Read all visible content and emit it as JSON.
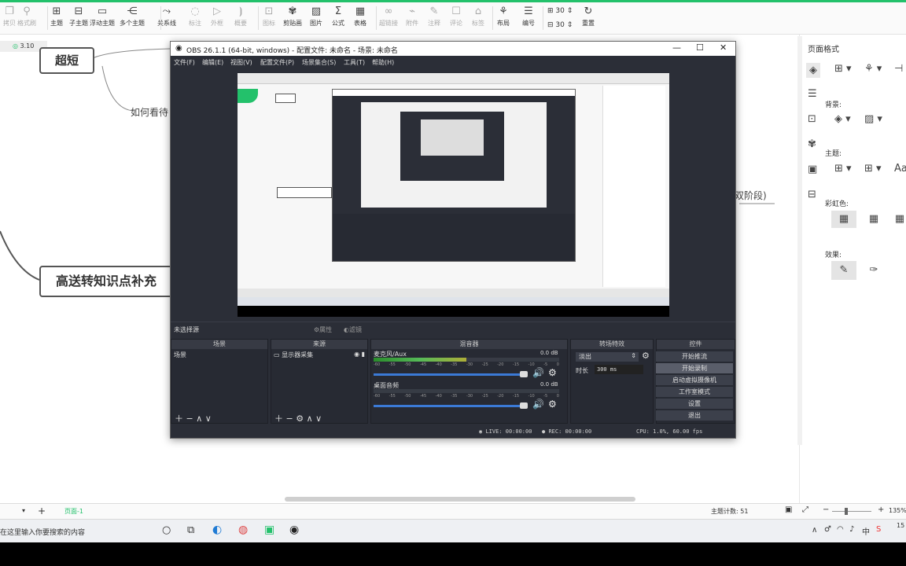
{
  "toolbar": {
    "items": [
      {
        "label": "拷贝",
        "icon": "copy-icon",
        "glyph": "❐",
        "disabled": true
      },
      {
        "label": "格式刷",
        "icon": "format-brush-icon",
        "glyph": "⚲",
        "disabled": true
      },
      {
        "label": "主题",
        "icon": "topic-icon",
        "glyph": "⊞",
        "disabled": false
      },
      {
        "label": "子主题",
        "icon": "subtopic-icon",
        "glyph": "⊟",
        "disabled": false
      },
      {
        "label": "浮动主题",
        "icon": "floating-topic-icon",
        "glyph": "▭",
        "disabled": false
      },
      {
        "label": "多个主题",
        "icon": "multi-topic-icon",
        "glyph": "⋲",
        "disabled": false
      },
      {
        "label": "关系线",
        "icon": "relation-line-icon",
        "glyph": "⤳",
        "disabled": false
      },
      {
        "label": "标注",
        "icon": "callout-icon",
        "glyph": "◌",
        "disabled": true
      },
      {
        "label": "外框",
        "icon": "boundary-icon",
        "glyph": "▷",
        "disabled": true
      },
      {
        "label": "概要",
        "icon": "summary-icon",
        "glyph": "⦘",
        "disabled": true
      },
      {
        "label": "图标",
        "icon": "icon-library-icon",
        "glyph": "⊡",
        "disabled": true
      },
      {
        "label": "剪贴画",
        "icon": "clipart-icon",
        "glyph": "✾",
        "disabled": false
      },
      {
        "label": "图片",
        "icon": "image-icon",
        "glyph": "▨",
        "disabled": false
      },
      {
        "label": "公式",
        "icon": "formula-icon",
        "glyph": "Σ",
        "disabled": false
      },
      {
        "label": "表格",
        "icon": "table-icon",
        "glyph": "▦",
        "disabled": false
      },
      {
        "label": "超链接",
        "icon": "hyperlink-icon",
        "glyph": "∞",
        "disabled": true
      },
      {
        "label": "附件",
        "icon": "attachment-icon",
        "glyph": "⌁",
        "disabled": true
      },
      {
        "label": "注释",
        "icon": "note-icon",
        "glyph": "✎",
        "disabled": true
      },
      {
        "label": "评论",
        "icon": "comment-icon",
        "glyph": "☐",
        "disabled": true
      },
      {
        "label": "标签",
        "icon": "tag-icon",
        "glyph": "⌂",
        "disabled": true
      },
      {
        "label": "布局",
        "icon": "layout-icon",
        "glyph": "⚘",
        "disabled": false
      },
      {
        "label": "编号",
        "icon": "numbering-icon",
        "glyph": "☰",
        "disabled": false
      },
      {
        "label": "重置",
        "icon": "reset-icon",
        "glyph": "↻",
        "disabled": false
      }
    ],
    "spacing_h": "30",
    "spacing_v": "30"
  },
  "doc_tab": {
    "version": "3.10"
  },
  "mindmap": {
    "node_top": "超短",
    "node_mid": "高送转知识点补充",
    "text_left": "如何看待",
    "text_right": "双阶段)"
  },
  "right_panel": {
    "title": "页面格式",
    "background_label": "背景:",
    "theme_label": "主题:",
    "rainbow_label": "彩虹色:",
    "effect_label": "效果:"
  },
  "mm_status": {
    "page_tab": "页面-1",
    "topic_count": "主题计数: 51",
    "zoom": "135%"
  },
  "taskbar": {
    "search_placeholder": "在这里输入你要搜索的内容",
    "clock": "15"
  },
  "obs": {
    "title": "OBS 26.1.1 (64-bit, windows) - 配置文件: 未命名 - 场景: 未命名",
    "menu": [
      "文件(F)",
      "编辑(E)",
      "视图(V)",
      "配置文件(P)",
      "场景集合(S)",
      "工具(T)",
      "帮助(H)"
    ],
    "no_source": "未选择源",
    "properties": "属性",
    "filters": "滤镜",
    "docks": {
      "scenes": "场景",
      "sources": "来源",
      "mixer": "混音器",
      "transitions": "转场特效",
      "controls": "控件"
    },
    "scene_item": "场景",
    "source_item": "显示器采集",
    "mixer": [
      {
        "name": "麦克风/Aux",
        "db": "0.0 dB",
        "level": 0.5
      },
      {
        "name": "桌面音频",
        "db": "0.0 dB",
        "level": 0.0
      }
    ],
    "mixer_ticks": [
      "-60",
      "-55",
      "-50",
      "-45",
      "-40",
      "-35",
      "-30",
      "-25",
      "-20",
      "-15",
      "-10",
      "-5",
      "0"
    ],
    "transition": "淡出",
    "duration_label": "时长",
    "duration_value": "300 ms",
    "controls": [
      "开始推流",
      "开始录制",
      "启动虚拟摄像机",
      "工作室模式",
      "设置",
      "退出"
    ],
    "status": {
      "live": "LIVE: 00:00:00",
      "rec": "REC: 00:00:00",
      "cpu": "CPU: 1.0%, 60.00 fps"
    }
  }
}
